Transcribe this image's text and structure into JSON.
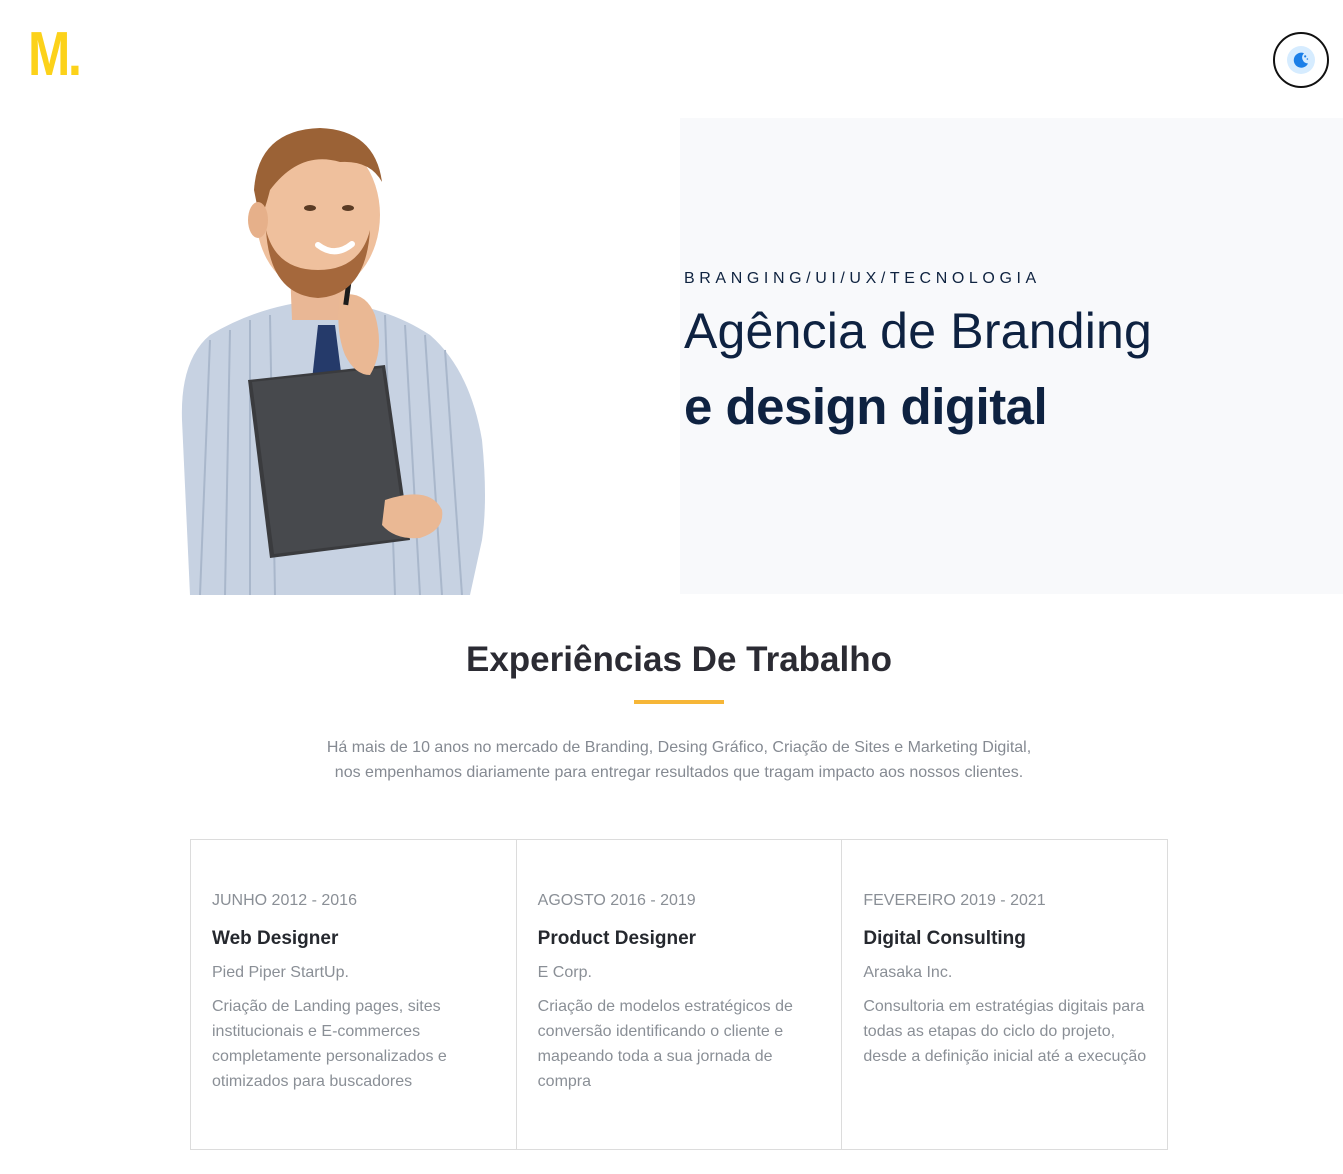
{
  "header": {
    "logo_text": "M.",
    "theme_toggle_icon": "moon-icon",
    "accent_color": "#fcd21a"
  },
  "hero": {
    "tagline": "BRANGING/UI/UX/TECNOLOGIA",
    "title_line1": "Agência de Branding",
    "title_line2": "e design digital",
    "image": "man-holding-folder-photo"
  },
  "experience": {
    "title": "Experiências De Trabalho",
    "intro": "Há mais de 10 anos no mercado de Branding, Desing Gráfico, Criação de Sites e Marketing Digital, nos empenhamos diariamente para entregar resultados que tragam impacto aos nossos clientes.",
    "underline_color": "#f6b637",
    "cards": [
      {
        "period": "JUNHO 2012 - 2016",
        "role": "Web Designer",
        "company": "Pied Piper StartUp.",
        "description": "Criação de Landing pages, sites institucionais e E-commerces completamente personalizados e otimizados para buscadores"
      },
      {
        "period": "AGOSTO 2016 - 2019",
        "role": "Product Designer",
        "company": "E Corp.",
        "description": "Criação de modelos estratégicos de conversão identificando o cliente e mapeando toda a sua jornada de compra"
      },
      {
        "period": "FEVEREIRO 2019 - 2021",
        "role": "Digital Consulting",
        "company": "Arasaka Inc.",
        "description": "Consultoria em estratégias digitais para todas as etapas do ciclo do projeto, desde a definição inicial até a execução"
      }
    ]
  }
}
